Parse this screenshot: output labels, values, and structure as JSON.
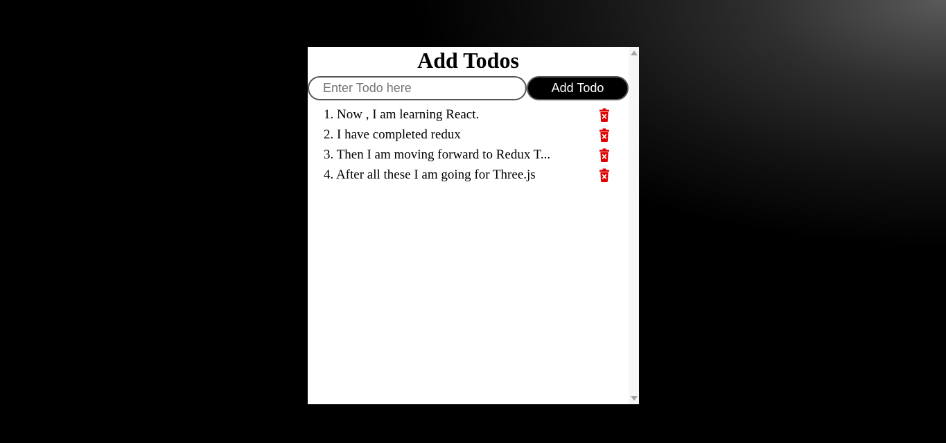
{
  "app": {
    "title": "Add Todos"
  },
  "form": {
    "input_value": "",
    "input_placeholder": "Enter Todo here",
    "add_button_label": "Add Todo"
  },
  "todos": [
    {
      "text": "1. Now , I am learning React."
    },
    {
      "text": "2. I have completed redux"
    },
    {
      "text": "3. Then I am moving forward to Redux T..."
    },
    {
      "text": "4. After all these I am going for Three.js"
    }
  ],
  "icons": {
    "delete": "trash-x-icon",
    "scroll_up": "scroll-up-arrow-icon",
    "scroll_down": "scroll-down-arrow-icon"
  },
  "colors": {
    "background": "#000000",
    "panel": "#ffffff",
    "button": "#000000",
    "delete_icon": "#e00000"
  }
}
